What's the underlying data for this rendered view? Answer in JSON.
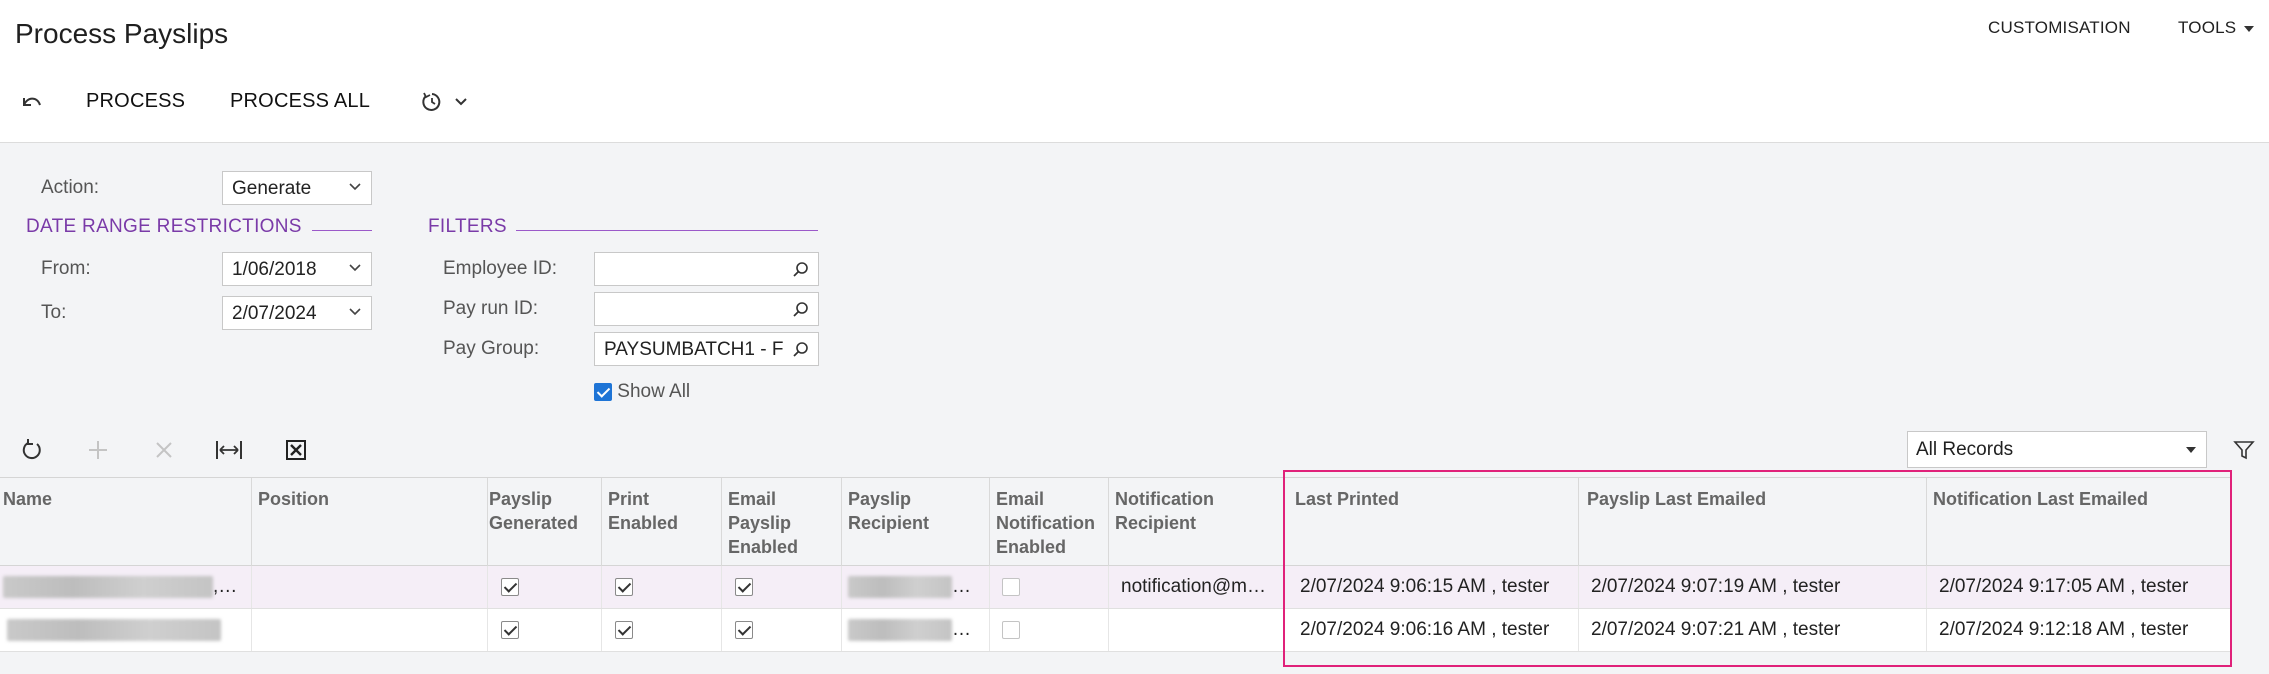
{
  "header": {
    "title": "Process Payslips",
    "customisation": "CUSTOMISATION",
    "tools": "TOOLS"
  },
  "toolbar": {
    "process": "PROCESS",
    "process_all": "PROCESS ALL"
  },
  "form": {
    "action_label": "Action:",
    "action_value": "Generate",
    "date_section": "DATE RANGE RESTRICTIONS",
    "from_label": "From:",
    "from_value": "1/06/2018",
    "to_label": "To:",
    "to_value": "2/07/2024",
    "filters_section": "FILTERS",
    "employee_label": "Employee ID:",
    "employee_value": "",
    "payrun_label": "Pay run ID:",
    "payrun_value": "",
    "paygroup_label": "Pay Group:",
    "paygroup_value": "PAYSUMBATCH1 - F",
    "show_all_label": "Show All",
    "show_all_checked": true
  },
  "grid": {
    "records_filter": "All Records",
    "columns": {
      "name": "Name",
      "position": "Position",
      "payslip_generated": "Payslip Generated",
      "print_enabled": "Print Enabled",
      "email_payslip_enabled": "Email Payslip Enabled",
      "payslip_recipient": "Payslip Recipient",
      "email_notification_enabled": "Email Notification Enabled",
      "notification_recipient": "Notification Recipient",
      "last_printed": "Last Printed",
      "payslip_last_emailed": "Payslip Last Emailed",
      "notification_last_emailed": "Notification Last Emailed"
    },
    "rows": [
      {
        "name_suffix": ",…",
        "payslip_generated": true,
        "print_enabled": true,
        "email_payslip_enabled": true,
        "recipient_suffix": "…",
        "email_notification_enabled": false,
        "notification_recipient": "notification@m…",
        "last_printed": "2/07/2024 9:06:15 AM , tester",
        "payslip_last_emailed": "2/07/2024 9:07:19 AM , tester",
        "notification_last_emailed": "2/07/2024 9:17:05 AM , tester"
      },
      {
        "name_suffix": "",
        "payslip_generated": true,
        "print_enabled": true,
        "email_payslip_enabled": true,
        "recipient_suffix": "…",
        "email_notification_enabled": false,
        "notification_recipient": "",
        "last_printed": "2/07/2024 9:06:16 AM , tester",
        "payslip_last_emailed": "2/07/2024 9:07:21 AM , tester",
        "notification_last_emailed": "2/07/2024 9:12:18 AM , tester"
      }
    ]
  },
  "colors": {
    "accent": "#7a3aa8",
    "highlight_border": "#e0217a",
    "selected_row": "#f5eef7"
  }
}
